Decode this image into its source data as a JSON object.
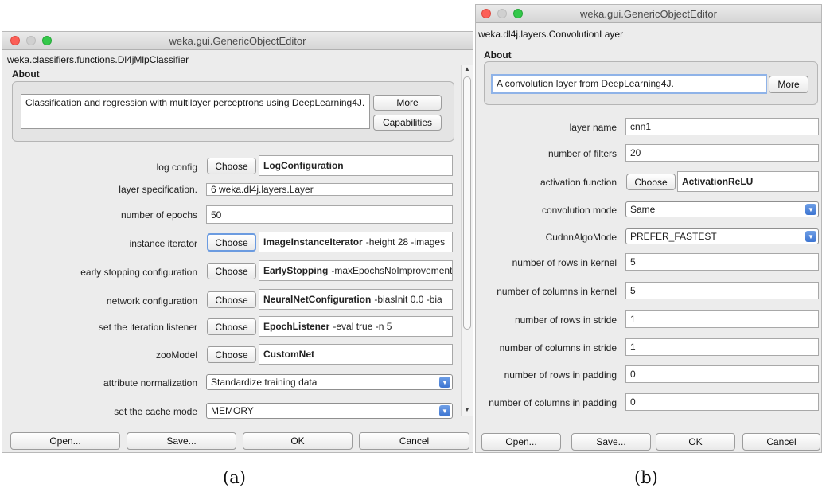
{
  "window_a": {
    "title": "weka.gui.GenericObjectEditor",
    "class_name": "weka.classifiers.functions.Dl4jMlpClassifier",
    "about_label": "About",
    "about_text": "Classification and regression with multilayer perceptrons using DeepLearning4J.",
    "more_label": "More",
    "capabilities_label": "Capabilities",
    "choose_label": "Choose",
    "properties": {
      "log_config": {
        "label": "log config",
        "bold": "LogConfiguration",
        "rest": ""
      },
      "layer_spec": {
        "label": "layer specification.",
        "value": "6 weka.dl4j.layers.Layer"
      },
      "epochs": {
        "label": "number of epochs",
        "value": "50"
      },
      "instance_iterator": {
        "label": "instance iterator",
        "bold": "ImageInstanceIterator",
        "rest": "-height 28 -images"
      },
      "early_stopping": {
        "label": "early stopping configuration",
        "bold": "EarlyStopping",
        "rest": "-maxEpochsNoImprovement"
      },
      "network_config": {
        "label": "network configuration",
        "bold": "NeuralNetConfiguration",
        "rest": "-biasInit 0.0 -bia"
      },
      "iteration_listener": {
        "label": "set the iteration listener",
        "bold": "EpochListener",
        "rest": "-eval true -n 5"
      },
      "zoo_model": {
        "label": "zooModel",
        "bold": "CustomNet",
        "rest": ""
      },
      "attr_norm": {
        "label": "attribute normalization",
        "value": "Standardize training data"
      },
      "cache_mode": {
        "label": "set the cache mode",
        "value": "MEMORY"
      }
    },
    "buttons": {
      "open": "Open...",
      "save": "Save...",
      "ok": "OK",
      "cancel": "Cancel"
    }
  },
  "window_b": {
    "title": "weka.gui.GenericObjectEditor",
    "class_name": "weka.dl4j.layers.ConvolutionLayer",
    "about_label": "About",
    "about_text": "A convolution layer from DeepLearning4J.",
    "more_label": "More",
    "choose_label": "Choose",
    "properties": {
      "layer_name": {
        "label": "layer name",
        "value": "cnn1"
      },
      "num_filters": {
        "label": "number of filters",
        "value": "20"
      },
      "activation": {
        "label": "activation function",
        "bold": "ActivationReLU"
      },
      "conv_mode": {
        "label": "convolution mode",
        "value": "Same"
      },
      "cudnn": {
        "label": "CudnnAlgoMode",
        "value": "PREFER_FASTEST"
      },
      "rows_kernel": {
        "label": "number of rows in kernel",
        "value": "5"
      },
      "cols_kernel": {
        "label": "number of columns in kernel",
        "value": "5"
      },
      "rows_stride": {
        "label": "number of rows in stride",
        "value": "1"
      },
      "cols_stride": {
        "label": "number of columns in stride",
        "value": "1"
      },
      "rows_padding": {
        "label": "number of rows in padding",
        "value": "0"
      },
      "cols_padding": {
        "label": "number of columns in padding",
        "value": "0"
      }
    },
    "buttons": {
      "open": "Open...",
      "save": "Save...",
      "ok": "OK",
      "cancel": "Cancel"
    }
  },
  "captions": {
    "a": "(a)",
    "b": "(b)"
  },
  "colors": {
    "close": "#fc5f57",
    "minimize": "#d0d0d0",
    "zoom": "#34c84a",
    "combo_arrow": "#3c74d1",
    "focus_ring": "#6b9be0"
  }
}
